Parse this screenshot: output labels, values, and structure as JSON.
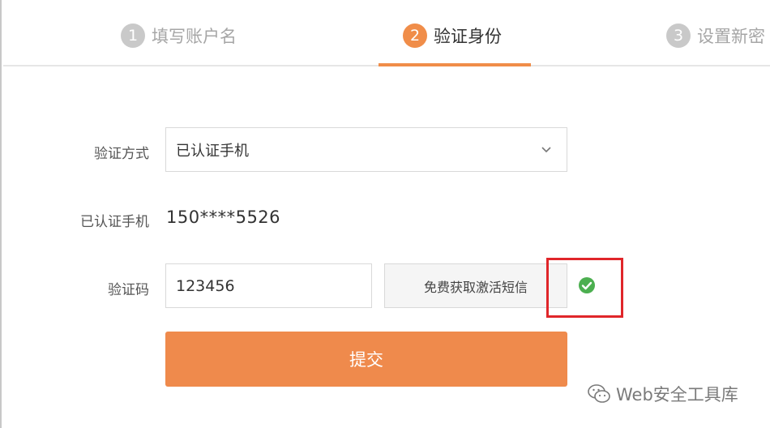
{
  "steps": [
    {
      "number": "1",
      "label": "填写账户名",
      "state": "done"
    },
    {
      "number": "2",
      "label": "验证身份",
      "state": "active"
    },
    {
      "number": "3",
      "label": "设置新密",
      "state": "pending"
    }
  ],
  "form": {
    "method_label": "验证方式",
    "method_value": "已认证手机",
    "phone_label": "已认证手机",
    "phone_value": "150****5526",
    "code_label": "验证码",
    "code_value": "123456",
    "sms_button_label": "免费获取激活短信",
    "submit_label": "提交"
  },
  "watermark": {
    "text": "Web安全工具库",
    "icon": "wechat-icon"
  },
  "colors": {
    "accent": "#ef8a4c",
    "highlight": "#e0262a",
    "success": "#4caf50",
    "step_inactive": "#c9c9c9"
  }
}
